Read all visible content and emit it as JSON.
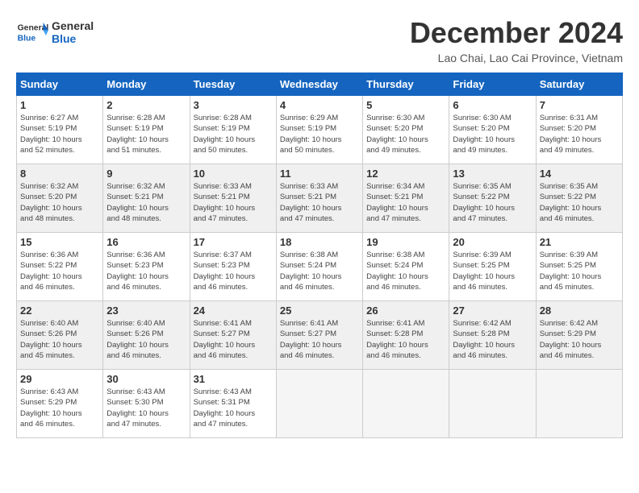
{
  "header": {
    "logo_line1": "General",
    "logo_line2": "Blue",
    "month_title": "December 2024",
    "location": "Lao Chai, Lao Cai Province, Vietnam"
  },
  "weekdays": [
    "Sunday",
    "Monday",
    "Tuesday",
    "Wednesday",
    "Thursday",
    "Friday",
    "Saturday"
  ],
  "weeks": [
    [
      {
        "day": 1,
        "info": "Sunrise: 6:27 AM\nSunset: 5:19 PM\nDaylight: 10 hours\nand 52 minutes."
      },
      {
        "day": 2,
        "info": "Sunrise: 6:28 AM\nSunset: 5:19 PM\nDaylight: 10 hours\nand 51 minutes."
      },
      {
        "day": 3,
        "info": "Sunrise: 6:28 AM\nSunset: 5:19 PM\nDaylight: 10 hours\nand 50 minutes."
      },
      {
        "day": 4,
        "info": "Sunrise: 6:29 AM\nSunset: 5:19 PM\nDaylight: 10 hours\nand 50 minutes."
      },
      {
        "day": 5,
        "info": "Sunrise: 6:30 AM\nSunset: 5:20 PM\nDaylight: 10 hours\nand 49 minutes."
      },
      {
        "day": 6,
        "info": "Sunrise: 6:30 AM\nSunset: 5:20 PM\nDaylight: 10 hours\nand 49 minutes."
      },
      {
        "day": 7,
        "info": "Sunrise: 6:31 AM\nSunset: 5:20 PM\nDaylight: 10 hours\nand 49 minutes."
      }
    ],
    [
      {
        "day": 8,
        "info": "Sunrise: 6:32 AM\nSunset: 5:20 PM\nDaylight: 10 hours\nand 48 minutes."
      },
      {
        "day": 9,
        "info": "Sunrise: 6:32 AM\nSunset: 5:21 PM\nDaylight: 10 hours\nand 48 minutes."
      },
      {
        "day": 10,
        "info": "Sunrise: 6:33 AM\nSunset: 5:21 PM\nDaylight: 10 hours\nand 47 minutes."
      },
      {
        "day": 11,
        "info": "Sunrise: 6:33 AM\nSunset: 5:21 PM\nDaylight: 10 hours\nand 47 minutes."
      },
      {
        "day": 12,
        "info": "Sunrise: 6:34 AM\nSunset: 5:21 PM\nDaylight: 10 hours\nand 47 minutes."
      },
      {
        "day": 13,
        "info": "Sunrise: 6:35 AM\nSunset: 5:22 PM\nDaylight: 10 hours\nand 47 minutes."
      },
      {
        "day": 14,
        "info": "Sunrise: 6:35 AM\nSunset: 5:22 PM\nDaylight: 10 hours\nand 46 minutes."
      }
    ],
    [
      {
        "day": 15,
        "info": "Sunrise: 6:36 AM\nSunset: 5:22 PM\nDaylight: 10 hours\nand 46 minutes."
      },
      {
        "day": 16,
        "info": "Sunrise: 6:36 AM\nSunset: 5:23 PM\nDaylight: 10 hours\nand 46 minutes."
      },
      {
        "day": 17,
        "info": "Sunrise: 6:37 AM\nSunset: 5:23 PM\nDaylight: 10 hours\nand 46 minutes."
      },
      {
        "day": 18,
        "info": "Sunrise: 6:38 AM\nSunset: 5:24 PM\nDaylight: 10 hours\nand 46 minutes."
      },
      {
        "day": 19,
        "info": "Sunrise: 6:38 AM\nSunset: 5:24 PM\nDaylight: 10 hours\nand 46 minutes."
      },
      {
        "day": 20,
        "info": "Sunrise: 6:39 AM\nSunset: 5:25 PM\nDaylight: 10 hours\nand 46 minutes."
      },
      {
        "day": 21,
        "info": "Sunrise: 6:39 AM\nSunset: 5:25 PM\nDaylight: 10 hours\nand 45 minutes."
      }
    ],
    [
      {
        "day": 22,
        "info": "Sunrise: 6:40 AM\nSunset: 5:26 PM\nDaylight: 10 hours\nand 45 minutes."
      },
      {
        "day": 23,
        "info": "Sunrise: 6:40 AM\nSunset: 5:26 PM\nDaylight: 10 hours\nand 46 minutes."
      },
      {
        "day": 24,
        "info": "Sunrise: 6:41 AM\nSunset: 5:27 PM\nDaylight: 10 hours\nand 46 minutes."
      },
      {
        "day": 25,
        "info": "Sunrise: 6:41 AM\nSunset: 5:27 PM\nDaylight: 10 hours\nand 46 minutes."
      },
      {
        "day": 26,
        "info": "Sunrise: 6:41 AM\nSunset: 5:28 PM\nDaylight: 10 hours\nand 46 minutes."
      },
      {
        "day": 27,
        "info": "Sunrise: 6:42 AM\nSunset: 5:28 PM\nDaylight: 10 hours\nand 46 minutes."
      },
      {
        "day": 28,
        "info": "Sunrise: 6:42 AM\nSunset: 5:29 PM\nDaylight: 10 hours\nand 46 minutes."
      }
    ],
    [
      {
        "day": 29,
        "info": "Sunrise: 6:43 AM\nSunset: 5:29 PM\nDaylight: 10 hours\nand 46 minutes."
      },
      {
        "day": 30,
        "info": "Sunrise: 6:43 AM\nSunset: 5:30 PM\nDaylight: 10 hours\nand 47 minutes."
      },
      {
        "day": 31,
        "info": "Sunrise: 6:43 AM\nSunset: 5:31 PM\nDaylight: 10 hours\nand 47 minutes."
      },
      null,
      null,
      null,
      null
    ]
  ]
}
